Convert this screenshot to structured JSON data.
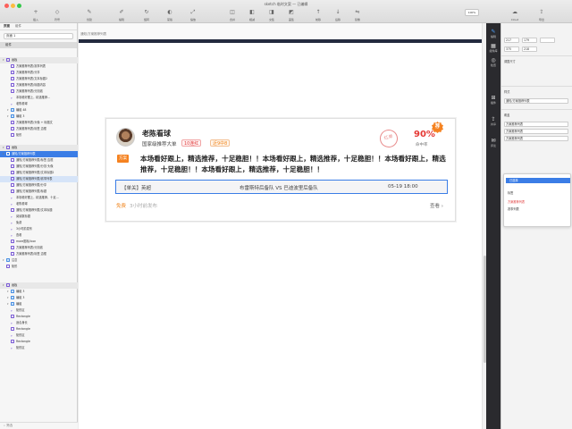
{
  "window": {
    "title": "sketch 临时文案 — 已编辑"
  },
  "toolbar": {
    "buttons": [
      {
        "label": "插入",
        "icon": "plus-icon"
      },
      {
        "label": "符号",
        "icon": "symbol-icon"
      },
      {
        "label": "创建",
        "icon": "create-icon"
      },
      {
        "label": "编辑",
        "icon": "edit-icon"
      },
      {
        "label": "旋转",
        "icon": "rotate-icon"
      },
      {
        "label": "蒙版",
        "icon": "mask-icon"
      },
      {
        "label": "缩放",
        "icon": "scale-icon"
      },
      {
        "label": "合并",
        "icon": "union-icon"
      },
      {
        "label": "相减",
        "icon": "subtract-icon"
      },
      {
        "label": "交集",
        "icon": "intersect-icon"
      },
      {
        "label": "差集",
        "icon": "difference-icon"
      },
      {
        "label": "前移",
        "icon": "forward-icon"
      },
      {
        "label": "后移",
        "icon": "backward-icon"
      },
      {
        "label": "镜像",
        "icon": "mirror-icon"
      },
      {
        "label": "Cloud",
        "icon": "cloud-icon"
      },
      {
        "label": "导出",
        "icon": "export-icon"
      }
    ],
    "zoom": "100%"
  },
  "left_panel": {
    "tabs": [
      "页面",
      "组件"
    ],
    "page_select": "页面 1",
    "current_page": "组件",
    "layers": [
      {
        "label": "画板",
        "kind": "section",
        "indent": 0
      },
      {
        "label": "方案推荐列表/赛事列表",
        "kind": "shape",
        "indent": 1
      },
      {
        "label": "方案推荐列表/分享",
        "kind": "shape",
        "indent": 1
      },
      {
        "label": "方案推荐列表/文本标题2",
        "kind": "shape",
        "indent": 1
      },
      {
        "label": "方案推荐列表/标题内容",
        "kind": "shape",
        "indent": 1
      },
      {
        "label": "方案推荐列表/分割线",
        "kind": "shape",
        "indent": 1
      },
      {
        "label": "本场看好跟上，精选推荐...",
        "kind": "text",
        "indent": 1
      },
      {
        "label": "老陈看球",
        "kind": "text",
        "indent": 1
      },
      {
        "label": "编组 48",
        "kind": "folder",
        "indent": 1
      },
      {
        "label": "编组 3",
        "kind": "folder",
        "indent": 1
      },
      {
        "label": "方案推荐列表/头像 + 标题文",
        "kind": "shape",
        "indent": 1
      },
      {
        "label": "方案推荐列表/标签 边框",
        "kind": "shape",
        "indent": 1
      },
      {
        "label": "矩形",
        "kind": "shape",
        "indent": 1
      },
      {
        "label": "",
        "kind": "gap",
        "indent": 0
      },
      {
        "label": "画板",
        "kind": "section",
        "indent": 0
      },
      {
        "label": "通知/方案推荐列表",
        "kind": "shape",
        "indent": 0,
        "selected": true
      },
      {
        "label": "通知/方案推荐列表/标签 边框",
        "kind": "shape",
        "indent": 1
      },
      {
        "label": "通知/方案推荐列表/分割 头像",
        "kind": "shape",
        "indent": 1
      },
      {
        "label": "通知/方案推荐列表/文本标题2",
        "kind": "shape",
        "indent": 1
      },
      {
        "label": "通知/方案推荐列表/赛事列表",
        "kind": "shape",
        "indent": 1,
        "highlight": true
      },
      {
        "label": "通知/方案推荐列表/分享",
        "kind": "shape",
        "indent": 1
      },
      {
        "label": "通知/方案推荐列表/标题",
        "kind": "shape",
        "indent": 1
      },
      {
        "label": "本场看好跟上，精选推荐，十足...",
        "kind": "text",
        "indent": 1
      },
      {
        "label": "老陈看球",
        "kind": "text",
        "indent": 1
      },
      {
        "label": "通知/方案推荐列表/文本标题",
        "kind": "shape",
        "indent": 1
      },
      {
        "label": "阅读数标题",
        "kind": "text",
        "indent": 1
      },
      {
        "label": "免费",
        "kind": "text",
        "indent": 1
      },
      {
        "label": "3小时前发布",
        "kind": "text",
        "indent": 1
      },
      {
        "label": "查看",
        "kind": "text",
        "indent": 1
      },
      {
        "label": "more图标/icon",
        "kind": "shape",
        "indent": 1
      },
      {
        "label": "方案推荐列表/分割线",
        "kind": "shape",
        "indent": 1
      },
      {
        "label": "方案推荐列表/标签 边框",
        "kind": "shape",
        "indent": 1
      },
      {
        "label": "注意",
        "kind": "folder",
        "indent": 0
      },
      {
        "label": "矩形",
        "kind": "shape",
        "indent": 0
      },
      {
        "label": "",
        "kind": "gap",
        "indent": 0
      },
      {
        "label": "",
        "kind": "gap",
        "indent": 0
      },
      {
        "label": "画板",
        "kind": "section",
        "indent": 0
      },
      {
        "label": "编组 3",
        "kind": "folder",
        "indent": 1
      },
      {
        "label": "编组 3",
        "kind": "folder",
        "indent": 1
      },
      {
        "label": "编组",
        "kind": "folder",
        "indent": 1
      },
      {
        "label": "矩形区",
        "kind": "text",
        "indent": 1
      },
      {
        "label": "Rectangle",
        "kind": "shape",
        "indent": 1
      },
      {
        "label": "适合身长",
        "kind": "text",
        "indent": 1
      },
      {
        "label": "Rectangle",
        "kind": "shape",
        "indent": 1
      },
      {
        "label": "矩形区",
        "kind": "text",
        "indent": 1
      },
      {
        "label": "Rectangle",
        "kind": "shape",
        "indent": 1
      },
      {
        "label": "矩形区",
        "kind": "text",
        "indent": 1
      }
    ],
    "footer": "筛选"
  },
  "canvas": {
    "artboard_label": "通知/方案推荐列表"
  },
  "card": {
    "author": "老陈看球",
    "intro": "国家级推荐大单",
    "tag_streak": "10连红",
    "tag_recent": "近9中8",
    "stamp": "红单",
    "percent": "90%",
    "percent_label": "命中率",
    "badge": "荐",
    "hot_tag": "方案",
    "content": "本场看好跟上，精选推荐，十足稳胆！！本场看好跟上，精选推荐，十足稳胆！！本场看好跟上，精选推荐，十足稳胆！！本场看好跟上，精选推荐，十足稳胆！！",
    "match": {
      "league": "【单关】英超",
      "teams": "布雷斯特后备队 VS 巴迪波里后备队",
      "time": "05-19  18:00"
    },
    "free": "免费",
    "posted": "3小时前发布",
    "view": "查看 ›"
  },
  "right_strip": {
    "items": [
      "编辑",
      "组件库",
      "检查",
      "插件",
      "共享",
      "评论"
    ]
  },
  "inspector": {
    "x": "217",
    "y": "179",
    "w": "375",
    "h": "218",
    "section_resize": "调整尺寸",
    "section_style": "样式",
    "style_value": "通知/方案推荐列表",
    "override_label": "覆盖",
    "override_items": [
      "方案推荐列表",
      "方案推荐列表",
      "方案推荐列表"
    ],
    "popup_title": "已选择",
    "popup_items": [
      "标签",
      "方案推荐列表",
      "赛事列表"
    ]
  },
  "colors": {
    "accent": "#3b7de6",
    "primary_red": "#e53935",
    "orange": "#f58220",
    "dark_bar": "#232a3e"
  }
}
